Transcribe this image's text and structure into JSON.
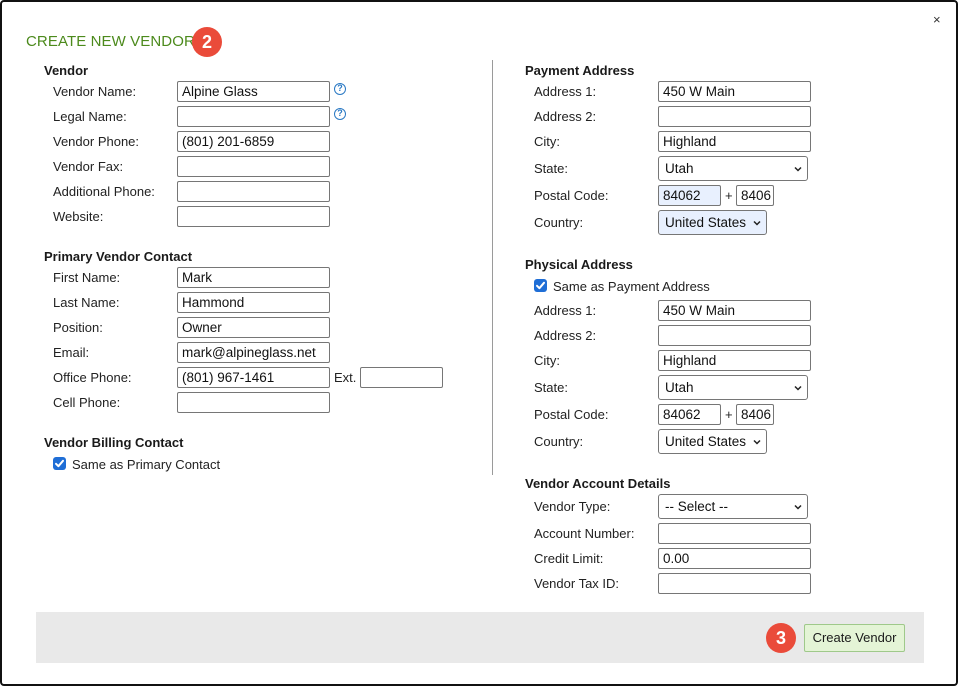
{
  "dialog": {
    "title": "CREATE NEW VENDOR",
    "close_glyph": "×",
    "title_step_badge": "2",
    "create_step_badge": "3",
    "create_button": "Create Vendor",
    "accent_color": "#4c8a1c",
    "badge_color": "#ea4b3a"
  },
  "vendor": {
    "heading": "Vendor",
    "name_label": "Vendor Name:",
    "name_value": "Alpine Glass",
    "legal_label": "Legal Name:",
    "legal_value": "",
    "phone_label": "Vendor Phone:",
    "phone_value": "(801) 201-6859",
    "fax_label": "Vendor Fax:",
    "fax_value": "",
    "addl_phone_label": "Additional Phone:",
    "addl_phone_value": "",
    "website_label": "Website:",
    "website_value": "",
    "help_glyph": "?"
  },
  "primary_contact": {
    "heading": "Primary Vendor Contact",
    "first_label": "First Name:",
    "first_value": "Mark",
    "last_label": "Last Name:",
    "last_value": "Hammond",
    "position_label": "Position:",
    "position_value": "Owner",
    "email_label": "Email:",
    "email_value": "mark@alpineglass.net",
    "office_label": "Office Phone:",
    "office_value": "(801) 967-1461",
    "ext_label": "Ext.",
    "ext_value": "",
    "cell_label": "Cell Phone:",
    "cell_value": ""
  },
  "billing_contact": {
    "heading": "Vendor Billing Contact",
    "same_label": "Same as Primary Contact",
    "same_checked": true
  },
  "payment_address": {
    "heading": "Payment Address",
    "addr1_label": "Address 1:",
    "addr1_value": "450 W Main",
    "addr2_label": "Address 2:",
    "addr2_value": "",
    "city_label": "City:",
    "city_value": "Highland",
    "state_label": "State:",
    "state_value": "Utah",
    "postal_label": "Postal Code:",
    "postal_value": "84062",
    "plus": "+",
    "postal_ext_value": "8406",
    "country_label": "Country:",
    "country_value": "United States"
  },
  "physical_address": {
    "heading": "Physical Address",
    "same_label": "Same as Payment Address",
    "same_checked": true,
    "addr1_label": "Address 1:",
    "addr1_value": "450 W Main",
    "addr2_label": "Address 2:",
    "addr2_value": "",
    "city_label": "City:",
    "city_value": "Highland",
    "state_label": "State:",
    "state_value": "Utah",
    "postal_label": "Postal Code:",
    "postal_value": "84062",
    "plus": "+",
    "postal_ext_value": "8406",
    "country_label": "Country:",
    "country_value": "United States"
  },
  "account_details": {
    "heading": "Vendor Account Details",
    "type_label": "Vendor Type:",
    "type_value": "-- Select --",
    "account_label": "Account Number:",
    "account_value": "",
    "credit_label": "Credit Limit:",
    "credit_value": "0.00",
    "tax_label": "Vendor Tax ID:",
    "tax_value": ""
  }
}
